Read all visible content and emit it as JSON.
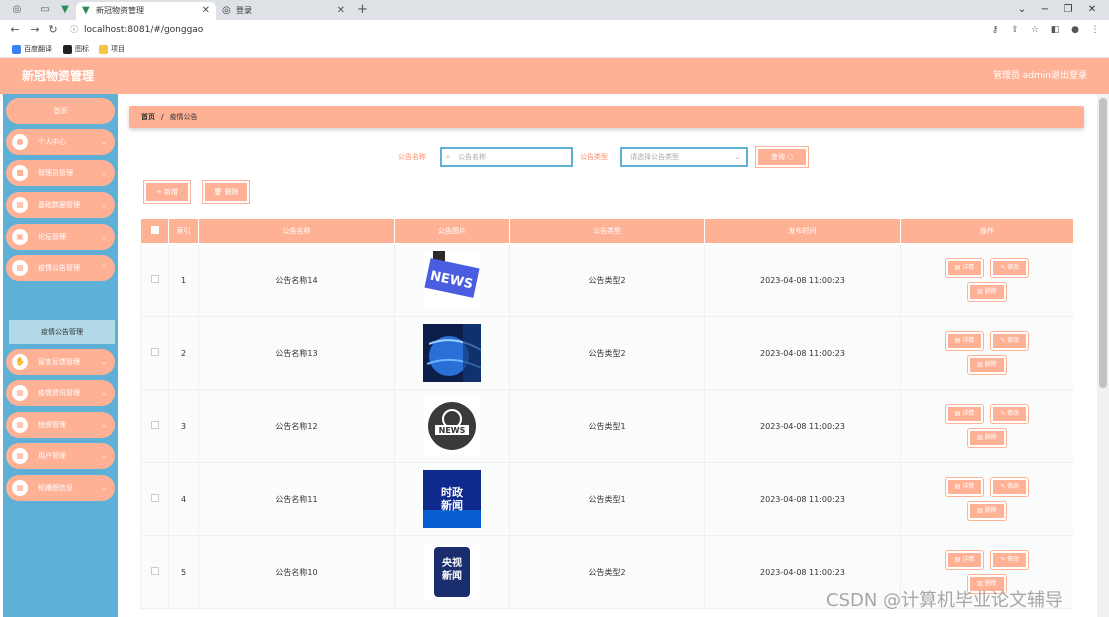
{
  "browser": {
    "tabs": [
      {
        "label": "新冠物资管理",
        "active": true
      },
      {
        "label": "登录",
        "active": false
      }
    ],
    "url": "localhost:8081/#/gonggao",
    "bookmarks": [
      "百度翻译",
      "图标",
      "项目"
    ]
  },
  "header": {
    "title": "新冠物资管理",
    "user": "管理员 admin",
    "logout": "退出登录"
  },
  "sidebar": {
    "home": "首页",
    "items": [
      {
        "label": "个人中心",
        "icon": "user-icon"
      },
      {
        "label": "管理员管理",
        "icon": "admin-icon"
      },
      {
        "label": "基础数据管理",
        "icon": "data-icon"
      },
      {
        "label": "论坛管理",
        "icon": "forum-icon"
      },
      {
        "label": "疫情公告管理",
        "icon": "notice-icon"
      },
      {
        "label": "留言反馈管理",
        "icon": "feedback-icon"
      },
      {
        "label": "疫情资讯管理",
        "icon": "news-icon"
      },
      {
        "label": "物资管理",
        "icon": "supplies-icon"
      },
      {
        "label": "用户管理",
        "icon": "users-icon"
      },
      {
        "label": "轮播图信息",
        "icon": "carousel-icon"
      }
    ],
    "active_sub": "疫情公告管理"
  },
  "breadcrumb": {
    "home": "首页",
    "current": "疫情公告"
  },
  "filters": {
    "name_label": "公告名称",
    "name_placeholder": "公告名称",
    "type_label": "公告类型",
    "type_placeholder": "请选择公告类型",
    "query": "查询"
  },
  "actions": {
    "add": "新增",
    "delete": "删除"
  },
  "table": {
    "headers": [
      "索引",
      "公告名称",
      "公告图片",
      "公告类型",
      "发布时间",
      "操作"
    ],
    "ops": {
      "detail": "详情",
      "edit": "修改",
      "delete": "删除"
    },
    "rows": [
      {
        "index": "1",
        "name": "公告名称14",
        "type": "公告类型2",
        "time": "2023-04-08 11:00:23",
        "img": "NEWS"
      },
      {
        "index": "2",
        "name": "公告名称13",
        "type": "公告类型2",
        "time": "2023-04-08 11:00:23",
        "img": ""
      },
      {
        "index": "3",
        "name": "公告名称12",
        "type": "公告类型1",
        "time": "2023-04-08 11:00:23",
        "img": "NEWS"
      },
      {
        "index": "4",
        "name": "公告名称11",
        "type": "公告类型1",
        "time": "2023-04-08 11:00:23",
        "img": "时政新闻"
      },
      {
        "index": "5",
        "name": "公告名称10",
        "type": "公告类型2",
        "time": "2023-04-08 11:00:23",
        "img": "央视新闻"
      }
    ]
  },
  "watermark": "CSDN @计算机毕业论文辅导",
  "colors": {
    "accent": "#ffb196",
    "sidebar": "#5eb0d6"
  }
}
